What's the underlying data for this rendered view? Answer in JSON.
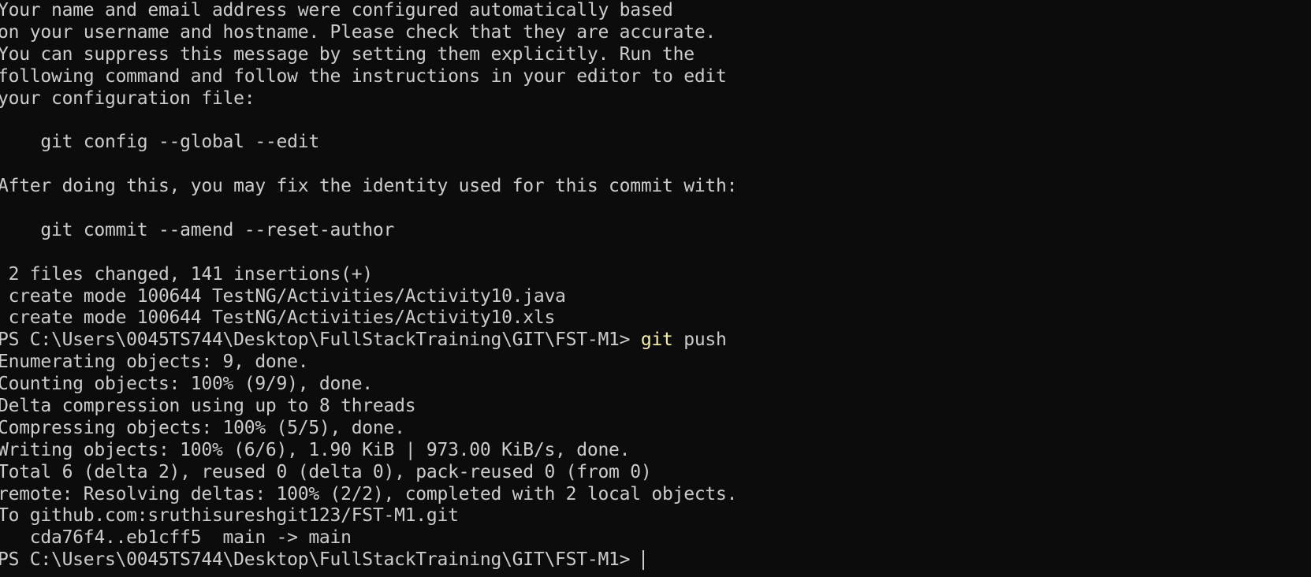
{
  "terminal": {
    "lines": [
      "Your name and email address were configured automatically based",
      "on your username and hostname. Please check that they are accurate.",
      "You can suppress this message by setting them explicitly. Run the",
      "following command and follow the instructions in your editor to edit",
      "your configuration file:",
      "",
      "    git config --global --edit",
      "",
      "After doing this, you may fix the identity used for this commit with:",
      "",
      "    git commit --amend --reset-author",
      "",
      " 2 files changed, 141 insertions(+)",
      " create mode 100644 TestNG/Activities/Activity10.java",
      " create mode 100644 TestNG/Activities/Activity10.xls"
    ],
    "prompt1": "PS C:\\Users\\0045TS744\\Desktop\\FullStackTraining\\GIT\\FST-M1> ",
    "command1_verb": "git",
    "command1_rest": " push",
    "output": [
      "Enumerating objects: 9, done.",
      "Counting objects: 100% (9/9), done.",
      "Delta compression using up to 8 threads",
      "Compressing objects: 100% (5/5), done.",
      "Writing objects: 100% (6/6), 1.90 KiB | 973.00 KiB/s, done.",
      "Total 6 (delta 2), reused 0 (delta 0), pack-reused 0 (from 0)",
      "remote: Resolving deltas: 100% (2/2), completed with 2 local objects.",
      "To github.com:sruthisureshgit123/FST-M1.git",
      "   cda76f4..eb1cff5  main -> main"
    ],
    "prompt2": "PS C:\\Users\\0045TS744\\Desktop\\FullStackTraining\\GIT\\FST-M1> ",
    "colors": {
      "background": "#0c0c0c",
      "text": "#cccccc",
      "command": "#f9f1a5"
    }
  }
}
